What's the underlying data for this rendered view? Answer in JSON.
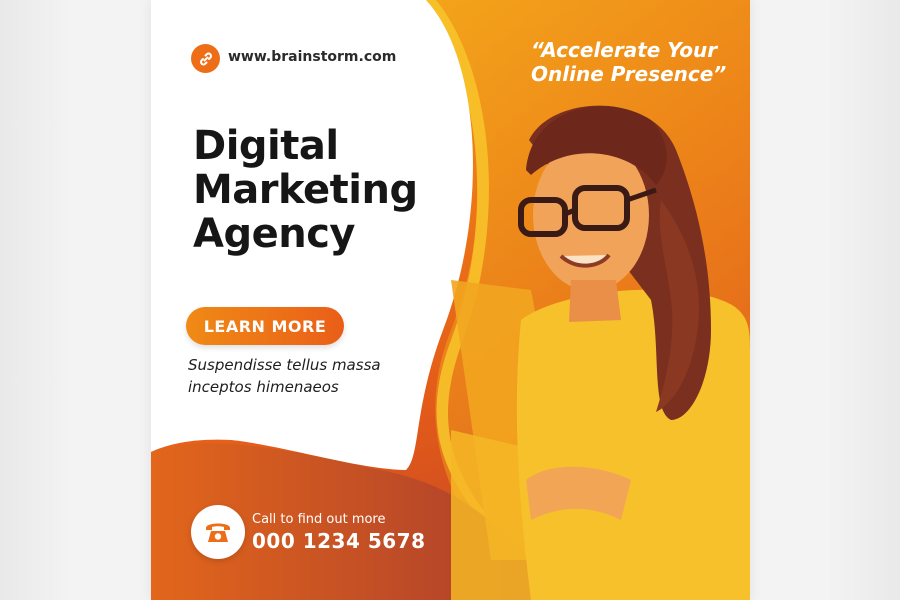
{
  "brand": {
    "website": "www.brainstorm.com"
  },
  "headline": {
    "line1": "Digital",
    "line2": "Marketing",
    "line3": "Agency"
  },
  "cta": {
    "label": "LEARN MORE"
  },
  "tagline": {
    "line1": "Suspendisse tellus massa",
    "line2": "inceptos himenaeos"
  },
  "quote": {
    "line1": "“Accelerate Your",
    "line2": "Online Presence”"
  },
  "contact": {
    "label": "Call to find out more",
    "number": "000 1234 5678"
  },
  "icons": {
    "website": "link-icon",
    "phone": "phone-icon"
  },
  "colors": {
    "accent": "#ee6d17",
    "orange_light": "#f6a21a",
    "orange_dark": "#b5402d",
    "text_dark": "#161616"
  }
}
